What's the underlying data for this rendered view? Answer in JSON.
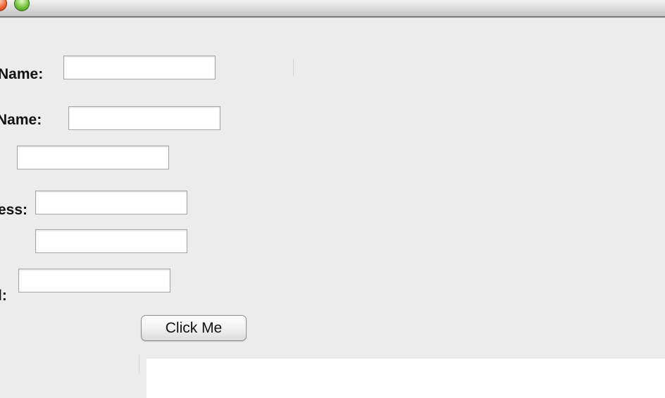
{
  "form": {
    "fields": [
      {
        "label": "Name:",
        "value": ""
      },
      {
        "label": "Name:",
        "value": ""
      },
      {
        "label": "",
        "value": ""
      },
      {
        "label": "ess:",
        "value": ""
      },
      {
        "label": "",
        "value": ""
      },
      {
        "label": "l:",
        "value": ""
      }
    ],
    "button_label": "Click Me"
  },
  "output_text": ""
}
